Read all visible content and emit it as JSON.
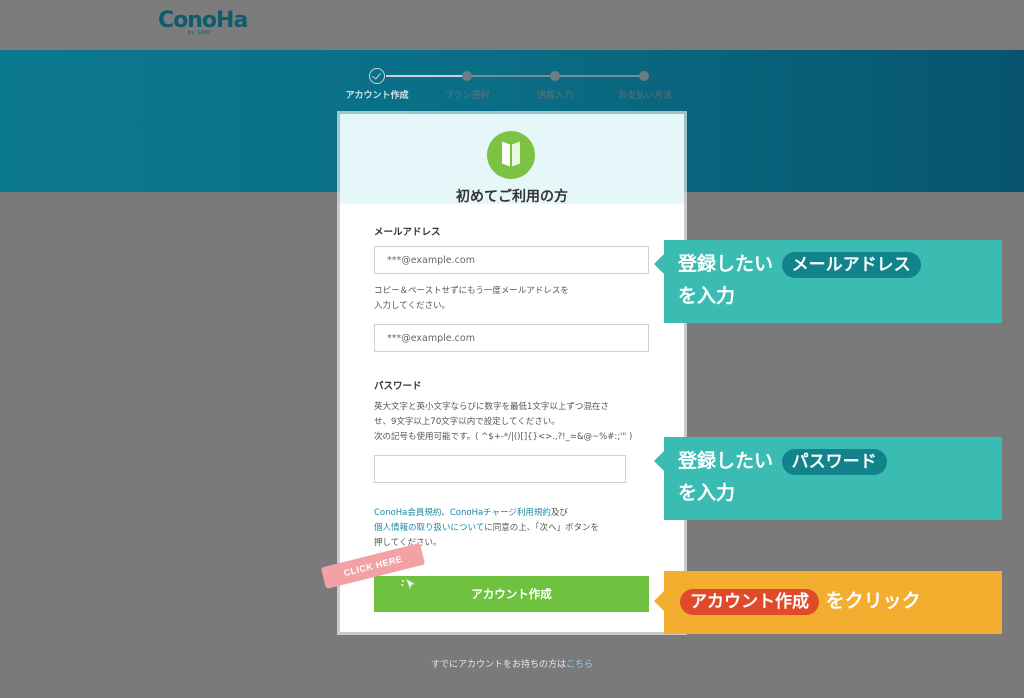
{
  "brand": {
    "logo_text": "ConoHa",
    "logo_sub": "by GMO"
  },
  "steps": [
    {
      "label": "アカウント作成",
      "state": "done"
    },
    {
      "label": "プラン選択",
      "state": "pending"
    },
    {
      "label": "情報入力",
      "state": "pending"
    },
    {
      "label": "お支払い方法",
      "state": "pending"
    }
  ],
  "card": {
    "title": "初めてご利用の方",
    "email_label": "メールアドレス",
    "email_placeholder": "***@example.com",
    "email_confirm_note_1": "コピー＆ペーストせずにもう一度メールアドレスを",
    "email_confirm_note_2": "入力してください。",
    "email_confirm_placeholder": "***@example.com",
    "password_label": "パスワード",
    "password_note_1": "英大文字と英小文字ならびに数字を最低1文字以上ずつ混在さ",
    "password_note_2": "せ、9文字以上70文字以内で設定してください。",
    "password_note_3": "次の記号も使用可能です。( ^$+-*/|()[]{}<>.,?!_=&@~%#:;'\" )",
    "password_value": "",
    "terms_link_1": "ConoHa会員規約",
    "terms_sep_1": "、",
    "terms_link_2": "ConoHaチャージ利用規約",
    "terms_and": "及び",
    "terms_link_3": "個人情報の取り扱いについて",
    "terms_tail": "に同意の上、「次へ」ボタンを",
    "terms_tail_2": "押してください。",
    "submit_label": "アカウント作成"
  },
  "click_tag": "CLICK HERE",
  "callouts": {
    "email": {
      "line1_prefix": "登録したい",
      "pill": "メールアドレス",
      "line2": "を入力"
    },
    "password": {
      "line1_prefix": "登録したい",
      "pill": "パスワード",
      "line2": "を入力"
    },
    "submit": {
      "pill": "アカウント作成",
      "suffix": "をクリック"
    }
  },
  "footer": {
    "text": "すでにアカウントをお持ちの方は",
    "link": "こちら"
  },
  "colors": {
    "band": "#0b7990",
    "button_green": "#6fc240",
    "callout_teal": "#3bbcb3",
    "callout_orange": "#f3ad2f",
    "pill_teal": "#12838b",
    "pill_red": "#e04a2a"
  }
}
